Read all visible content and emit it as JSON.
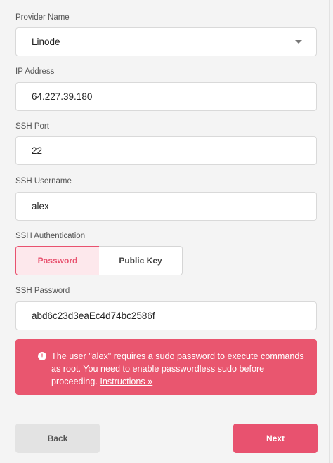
{
  "form": {
    "provider": {
      "label": "Provider Name",
      "value": "Linode"
    },
    "ip": {
      "label": "IP Address",
      "value": "64.227.39.180"
    },
    "port": {
      "label": "SSH Port",
      "value": "22"
    },
    "username": {
      "label": "SSH Username",
      "value": "alex"
    },
    "auth": {
      "label": "SSH Authentication",
      "options": [
        "Password",
        "Public Key"
      ],
      "selected": "Password"
    },
    "password": {
      "label": "SSH Password",
      "value": "abd6c23d3eaEc4d74bc2586f"
    }
  },
  "alert": {
    "icon": "exclamation-icon",
    "text": "The user \"alex\" requires a sudo password to execute commands as root. You need to enable passwordless sudo before proceeding.",
    "link": "Instructions »"
  },
  "buttons": {
    "back": "Back",
    "next": "Next"
  },
  "colors": {
    "accent": "#e8526f",
    "alert_bg": "#e9566f",
    "selected_bg": "#fde8ec"
  }
}
